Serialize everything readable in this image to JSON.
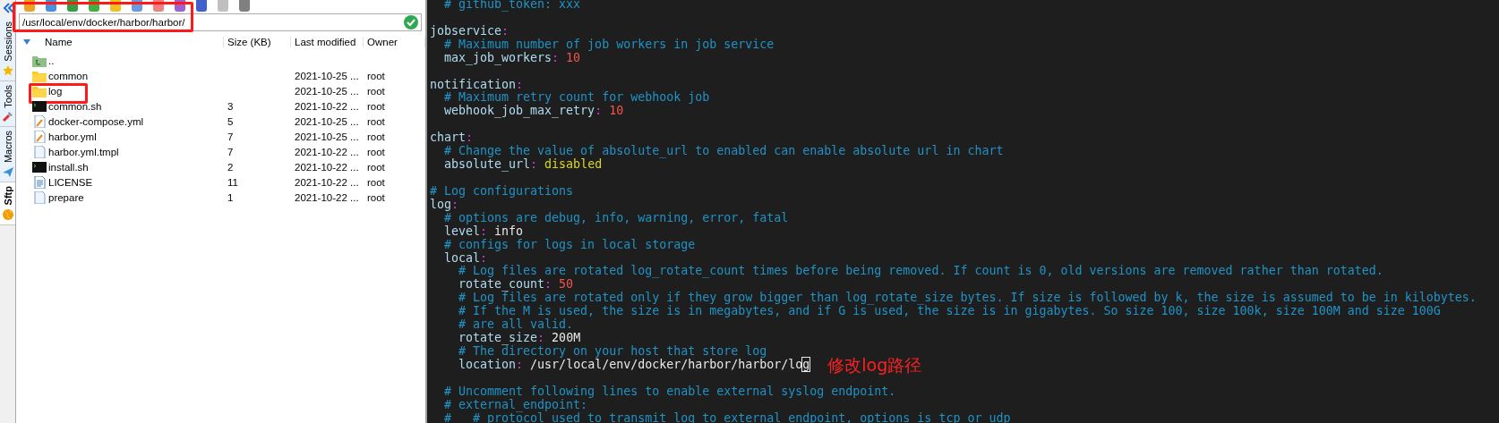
{
  "sidebar_tabs": [
    {
      "label": "Sessions",
      "selected": false
    },
    {
      "label": "Tools",
      "selected": false
    },
    {
      "label": "Macros",
      "selected": false
    },
    {
      "label": "Sftp",
      "selected": true
    }
  ],
  "path_field": {
    "value": "/usr/local/env/docker/harbor/harbor/",
    "highlighted": true
  },
  "columns": [
    "Name",
    "Size (KB)",
    "Last modified",
    "Owner"
  ],
  "files": [
    {
      "name": "..",
      "kind": "parent",
      "highlighted": false
    },
    {
      "name": "common",
      "kind": "folder",
      "modified": "2021-10-25 ...",
      "owner": "root",
      "highlighted": false
    },
    {
      "name": "log",
      "kind": "folder",
      "modified": "2021-10-25 ...",
      "owner": "root",
      "highlighted": true
    },
    {
      "name": "common.sh",
      "kind": "script",
      "size": "3",
      "modified": "2021-10-22 ...",
      "owner": "root",
      "highlighted": false
    },
    {
      "name": "docker-compose.yml",
      "kind": "edit",
      "size": "5",
      "modified": "2021-10-25 ...",
      "owner": "root",
      "highlighted": false
    },
    {
      "name": "harbor.yml",
      "kind": "edit",
      "size": "7",
      "modified": "2021-10-25 ...",
      "owner": "root",
      "highlighted": false
    },
    {
      "name": "harbor.yml.tmpl",
      "kind": "file",
      "size": "7",
      "modified": "2021-10-22 ...",
      "owner": "root",
      "highlighted": false
    },
    {
      "name": "install.sh",
      "kind": "script",
      "size": "2",
      "modified": "2021-10-22 ...",
      "owner": "root",
      "highlighted": false
    },
    {
      "name": "LICENSE",
      "kind": "text",
      "size": "11",
      "modified": "2021-10-22 ...",
      "owner": "root",
      "highlighted": false
    },
    {
      "name": "prepare",
      "kind": "file",
      "size": "1",
      "modified": "2021-10-22 ...",
      "owner": "root",
      "highlighted": false
    }
  ],
  "terminal_lines": [
    {
      "kind": "comment",
      "text": "  # github_token: xxx"
    },
    {
      "kind": "blank"
    },
    {
      "kind": "section",
      "key": "jobservice",
      "separator": ":"
    },
    {
      "kind": "comment",
      "text": "  # Maximum number of job workers in job service"
    },
    {
      "kind": "number",
      "key": "  max_job_workers",
      "separator": ":",
      "value": "10"
    },
    {
      "kind": "blank"
    },
    {
      "kind": "section",
      "key": "notification",
      "separator": ":"
    },
    {
      "kind": "comment",
      "text": "  # Maximum retry count for webhook job"
    },
    {
      "kind": "number",
      "key": "  webhook_job_max_retry",
      "separator": ":",
      "value": "10"
    },
    {
      "kind": "blank"
    },
    {
      "kind": "section",
      "key": "chart",
      "separator": ":"
    },
    {
      "kind": "comment",
      "text": "  # Change the value of absolute_url to enabled can enable absolute url in chart"
    },
    {
      "kind": "keyword",
      "key": "  absolute_url",
      "separator": ":",
      "value": "disabled"
    },
    {
      "kind": "blank"
    },
    {
      "kind": "comment",
      "text": "# Log configurations"
    },
    {
      "kind": "section",
      "key": "log",
      "separator": ":"
    },
    {
      "kind": "comment",
      "text": "  # options are debug, info, warning, error, fatal"
    },
    {
      "kind": "text",
      "key": "  level",
      "separator": ":",
      "value": "info"
    },
    {
      "kind": "comment",
      "text": "  # configs for logs in local storage"
    },
    {
      "kind": "section",
      "key": "  local",
      "separator": ":"
    },
    {
      "kind": "comment",
      "text": "    # Log files are rotated log_rotate_count times before being removed. If count is 0, old versions are removed rather than rotated."
    },
    {
      "kind": "number",
      "key": "    rotate_count",
      "separator": ":",
      "value": "50"
    },
    {
      "kind": "comment",
      "text": "    # Log files are rotated only if they grow bigger than log_rotate_size bytes. If size is followed by k, the size is assumed to be in kilobytes."
    },
    {
      "kind": "comment",
      "text": "    # If the M is used, the size is in megabytes, and if G is used, the size is in gigabytes. So size 100, size 100k, size 100M and size 100G"
    },
    {
      "kind": "comment",
      "text": "    # are all valid."
    },
    {
      "kind": "text",
      "key": "    rotate_size",
      "separator": ":",
      "value": "200M"
    },
    {
      "kind": "comment",
      "text": "    # The directory on your host that store log"
    },
    {
      "kind": "text",
      "key": "    location",
      "separator": ":",
      "value": "/usr/local/env/docker/harbor/harbor/log",
      "cursor": true,
      "note": "修改log路径"
    },
    {
      "kind": "blank"
    },
    {
      "kind": "comment",
      "text": "  # Uncomment following lines to enable external syslog endpoint."
    },
    {
      "kind": "comment",
      "text": "  # external_endpoint:"
    },
    {
      "kind": "comment",
      "text": "  #   # protocol used to transmit log to external endpoint, options is tcp or udp"
    }
  ]
}
